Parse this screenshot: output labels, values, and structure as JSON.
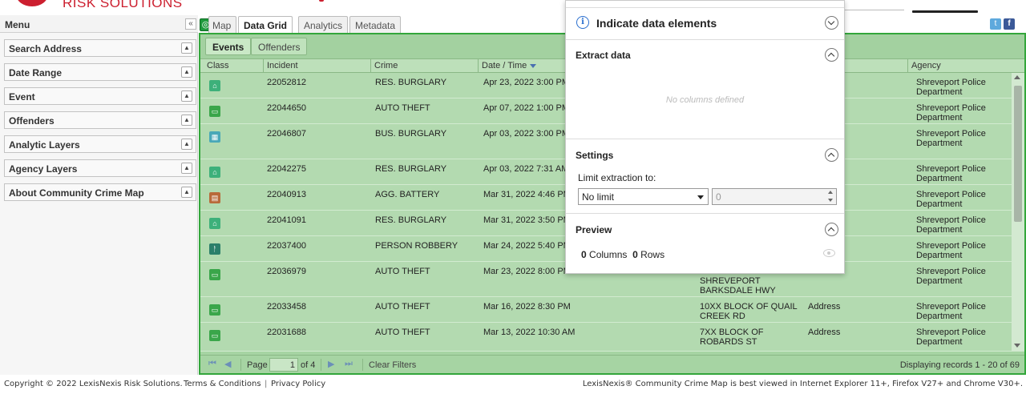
{
  "brand": {
    "text": "RISK SOLUTIONS"
  },
  "menu": {
    "title": "Menu",
    "collapse_glyph": "«",
    "items": [
      {
        "label": "Search Address"
      },
      {
        "label": "Date Range"
      },
      {
        "label": "Event"
      },
      {
        "label": "Offenders"
      },
      {
        "label": "Analytic Layers"
      },
      {
        "label": "Agency Layers"
      },
      {
        "label": "About Community Crime Map"
      }
    ]
  },
  "tabs": {
    "map": "Map",
    "data_grid": "Data Grid",
    "analytics": "Analytics",
    "metadata": "Metadata"
  },
  "subtabs": {
    "events": "Events",
    "offenders": "Offenders"
  },
  "grid": {
    "columns": {
      "class": "Class",
      "incident": "Incident",
      "crime": "Crime",
      "datetime": "Date / Time",
      "agency": "Agency"
    },
    "rows": [
      {
        "icon": "res-burglary-icon",
        "incident": "22052812",
        "crime": "RES. BURGLARY",
        "datetime": "Apr 23, 2022 3:00 PM",
        "addr1": "",
        "addr2": "",
        "loc": "",
        "agency1": "Shreveport Police",
        "agency2": "Department"
      },
      {
        "icon": "auto-theft-icon",
        "incident": "22044650",
        "crime": "AUTO THEFT",
        "datetime": "Apr 07, 2022 1:00 PM",
        "addr1": "",
        "addr2": "",
        "loc": "",
        "agency1": "Shreveport Police",
        "agency2": "Department"
      },
      {
        "icon": "bus-burglary-icon",
        "incident": "22046807",
        "crime": "BUS. BURGLARY",
        "datetime": "Apr 03, 2022 3:00 PM",
        "addr1": "",
        "addr2": "",
        "loc": "",
        "agency1": "Shreveport Police",
        "agency2": "Department"
      },
      {
        "icon": "res-burglary-icon",
        "incident": "22042275",
        "crime": "RES. BURGLARY",
        "datetime": "Apr 03, 2022 7:31 AM",
        "addr1": "",
        "addr2": "",
        "loc": "",
        "agency1": "Shreveport Police",
        "agency2": "Department"
      },
      {
        "icon": "agg-battery-icon",
        "incident": "22040913",
        "crime": "AGG. BATTERY",
        "datetime": "Mar 31, 2022 4:46 PM",
        "addr1": "",
        "addr2": "",
        "loc": "",
        "agency1": "Shreveport Police",
        "agency2": "Department"
      },
      {
        "icon": "res-burglary-icon",
        "incident": "22041091",
        "crime": "RES. BURGLARY",
        "datetime": "Mar 31, 2022 3:50 PM",
        "addr1": "",
        "addr2": "",
        "loc": "",
        "agency1": "Shreveport Police",
        "agency2": "Department"
      },
      {
        "icon": "person-robbery-icon",
        "incident": "22037400",
        "crime": "PERSON ROBBERY",
        "datetime": "Mar 24, 2022 5:40 PM",
        "addr1": "",
        "addr2": "",
        "loc": "",
        "agency1": "Shreveport Police",
        "agency2": "Department"
      },
      {
        "icon": "auto-theft-icon",
        "incident": "22036979",
        "crime": "AUTO THEFT",
        "datetime": "Mar 23, 2022 8:00 PM",
        "addr1": "SHREVEPORT",
        "addr2": "BARKSDALE HWY",
        "loc": "",
        "agency1": "Shreveport Police",
        "agency2": "Department"
      },
      {
        "icon": "auto-theft-icon",
        "incident": "22033458",
        "crime": "AUTO THEFT",
        "datetime": "Mar 16, 2022 8:30 PM",
        "addr1": "10XX BLOCK OF QUAIL",
        "addr2": "CREEK RD",
        "loc": "Address",
        "agency1": "Shreveport Police",
        "agency2": "Department"
      },
      {
        "icon": "auto-theft-icon",
        "incident": "22031688",
        "crime": "AUTO THEFT",
        "datetime": "Mar 13, 2022 10:30 AM",
        "addr1": "7XX BLOCK OF",
        "addr2": "ROBARDS ST",
        "loc": "Address",
        "agency1": "Shreveport Police",
        "agency2": "Department"
      }
    ]
  },
  "pager": {
    "page_label": "Page",
    "page_value": "1",
    "of_label": "of 4",
    "clear_filters": "Clear Filters",
    "display": "Displaying records 1 - 20 of 69"
  },
  "overlay": {
    "title": "Indicate data elements",
    "extract_label": "Extract data",
    "empty_text": "No columns defined",
    "settings_label": "Settings",
    "limit_label": "Limit extraction to:",
    "limit_value": "No limit",
    "limit_number_placeholder": "0",
    "preview_label": "Preview",
    "columns_count": "0",
    "columns_label": "Columns",
    "rows_count": "0",
    "rows_label": "Rows"
  },
  "footer": {
    "copyright": "Copyright © 2022 LexisNexis Risk Solutions.",
    "terms": "Terms & Conditions",
    "pipe": "|",
    "privacy": "Privacy Policy",
    "note": "LexisNexis® Community Crime Map is best viewed in Internet Explorer 11+, Firefox V27+ and Chrome V30+."
  },
  "colors": {
    "brand_red": "#cc1f2f",
    "grid_green": "#a6d4a3",
    "grid_border": "#33a63b",
    "info_blue": "#2a6fcf"
  }
}
